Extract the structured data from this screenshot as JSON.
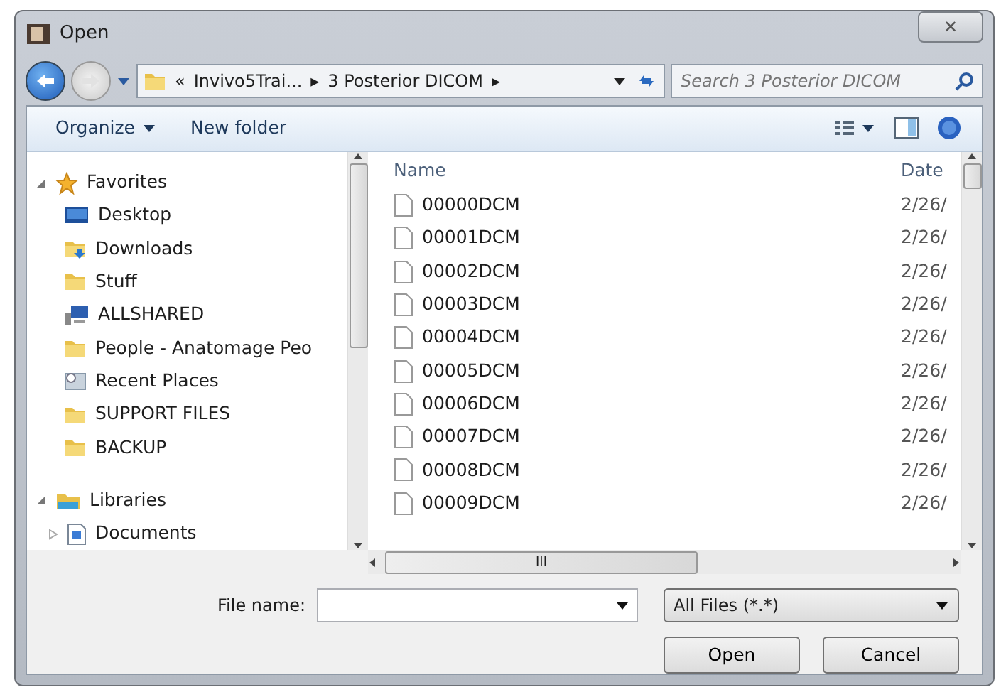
{
  "window": {
    "title": "Open",
    "close": "✕"
  },
  "address": {
    "overflow": "«",
    "crumbs": [
      "Invivo5Trai...",
      "3 Posterior DICOM"
    ],
    "separator": "▸"
  },
  "search": {
    "placeholder": "Search 3 Posterior DICOM"
  },
  "toolbar": {
    "organize": "Organize",
    "new_folder": "New folder"
  },
  "sidebar": {
    "items": [
      {
        "label": "Favorites",
        "kind": "star",
        "expanded": true,
        "children": [
          {
            "label": "Desktop",
            "kind": "desktop"
          },
          {
            "label": "Downloads",
            "kind": "downloads"
          },
          {
            "label": "Stuff",
            "kind": "folder"
          },
          {
            "label": "ALLSHARED",
            "kind": "network"
          },
          {
            "label": "People - Anatomage Peo",
            "kind": "folder"
          },
          {
            "label": "Recent Places",
            "kind": "recent"
          },
          {
            "label": "SUPPORT FILES",
            "kind": "folder"
          },
          {
            "label": "BACKUP",
            "kind": "folder"
          }
        ]
      },
      {
        "label": "Libraries",
        "kind": "library",
        "expanded": true,
        "children": [
          {
            "label": "Documents",
            "kind": "document",
            "expanded": false
          }
        ]
      }
    ]
  },
  "file_list": {
    "columns": [
      "Name",
      "Date"
    ],
    "scroll_grip": "III",
    "rows": [
      {
        "name": "00000DCM",
        "date": "2/26/"
      },
      {
        "name": "00001DCM",
        "date": "2/26/"
      },
      {
        "name": "00002DCM",
        "date": "2/26/"
      },
      {
        "name": "00003DCM",
        "date": "2/26/"
      },
      {
        "name": "00004DCM",
        "date": "2/26/"
      },
      {
        "name": "00005DCM",
        "date": "2/26/"
      },
      {
        "name": "00006DCM",
        "date": "2/26/"
      },
      {
        "name": "00007DCM",
        "date": "2/26/"
      },
      {
        "name": "00008DCM",
        "date": "2/26/"
      },
      {
        "name": "00009DCM",
        "date": "2/26/"
      }
    ]
  },
  "file_name": {
    "label": "File name:"
  },
  "file_type": {
    "value": "All Files (*.*)"
  },
  "buttons": [
    "Open",
    "Cancel"
  ]
}
